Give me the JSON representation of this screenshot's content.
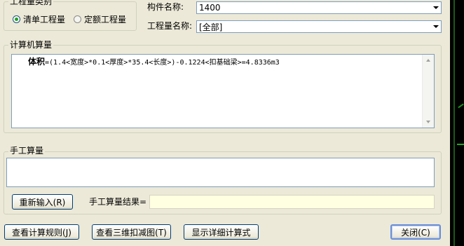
{
  "quantity_type": {
    "title": "工程量类别",
    "options": [
      {
        "label": "清单工程量",
        "selected": true
      },
      {
        "label": "定额工程量",
        "selected": false
      }
    ]
  },
  "component": {
    "name_label": "构件名称:",
    "name_value": "1400",
    "qty_label": "工程量名称:",
    "qty_value": "[全部]"
  },
  "computed": {
    "title": "计算机算量",
    "formula_bold": "体积",
    "formula_rest": "=(1.4<宽度>*0.1<厚度>*35.4<长度>)-0.1224<扣基础梁>=4.8336m3"
  },
  "manual": {
    "title": "手工算量",
    "input_value": "",
    "reenter_button": "重新输入(R)",
    "result_label": "手工算量结果=",
    "result_value": ""
  },
  "footer": {
    "view_rules": "查看计算规则(J)",
    "view_3d": "查看三维扣减图(T)",
    "show_detail": "显示详细计算式",
    "close": "关闭(C)"
  },
  "colors": {
    "dialog_bg": "#ece9d8",
    "result_field_bg": "#ffffe1",
    "radio_selected": "#21a121",
    "field_border": "#7f9db9"
  }
}
